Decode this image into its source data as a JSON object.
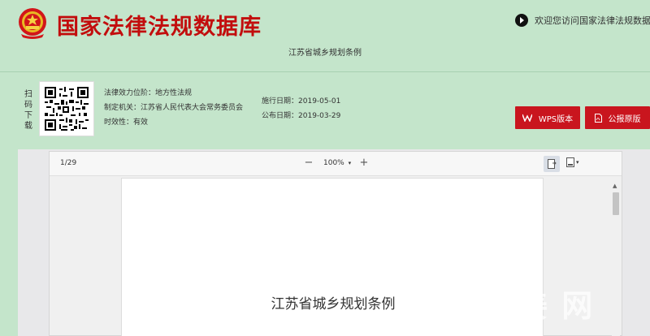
{
  "header": {
    "site_title": "国家法律法规数据库",
    "welcome_text": "欢迎您访问国家法律法规数据库",
    "document_title": "江苏省城乡规划条例"
  },
  "download": {
    "scan_label": "扫码下载"
  },
  "meta": {
    "effect_level_label": "法律效力位阶：",
    "effect_level_value": "地方性法规",
    "authority_label": "制定机关：",
    "authority_value": "江苏省人民代表大会常务委员会",
    "validity_label": "时效性：",
    "validity_value": "有效",
    "effective_date_label": "施行日期：",
    "effective_date_value": "2019-05-01",
    "publish_date_label": "公布日期：",
    "publish_date_value": "2019-03-29"
  },
  "buttons": {
    "wps_label": "WPS版本",
    "pdf_label": "公报原版"
  },
  "viewer": {
    "page_indicator": "1/29",
    "zoom_level": "100%",
    "zoom_out_symbol": "−",
    "zoom_in_symbol": "+",
    "document_heading": "江苏省城乡规划条例"
  },
  "watermark": "姜 网",
  "colors": {
    "page_bg": "#c4e5cb",
    "brand_red": "#c20d0d",
    "button_red": "#c9151e"
  },
  "icons": [
    "national-emblem-icon",
    "arrow-right-icon",
    "qr-code-icon",
    "wps-icon",
    "pdf-icon",
    "fit-page-icon",
    "page-view-icon"
  ]
}
